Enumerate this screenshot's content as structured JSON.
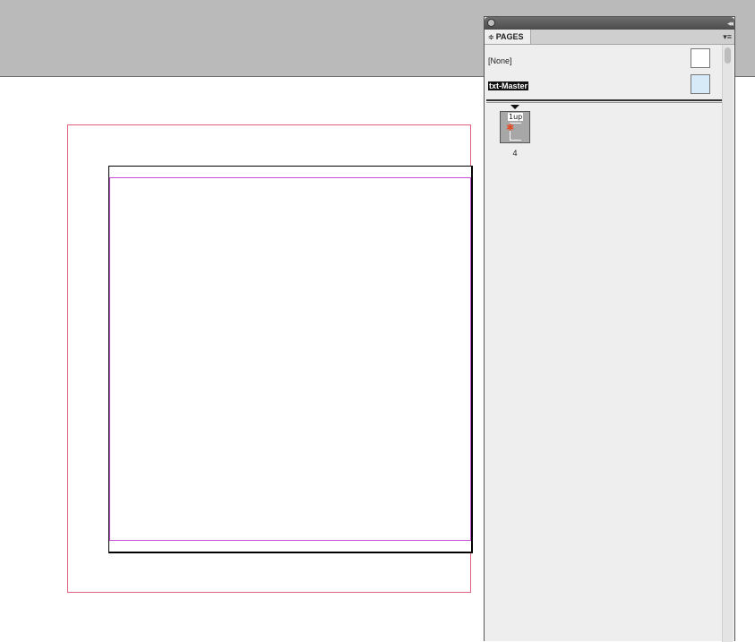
{
  "panel": {
    "tab_label": "PAGES",
    "tab_arrows": "≑",
    "menu_icon": "▾≡",
    "collapse_icon": "◂◂",
    "masters": [
      {
        "label": "[None]",
        "selected": false
      },
      {
        "label": "txt-Master",
        "selected": true
      }
    ],
    "pages": [
      {
        "prefix": "1up",
        "number": "4"
      }
    ]
  },
  "colors": {
    "bleed": "#e0607e",
    "margin": "#c94fd8",
    "selected_master_thumb": "#d6eaf8",
    "thumb_star": "#e24d2a"
  }
}
